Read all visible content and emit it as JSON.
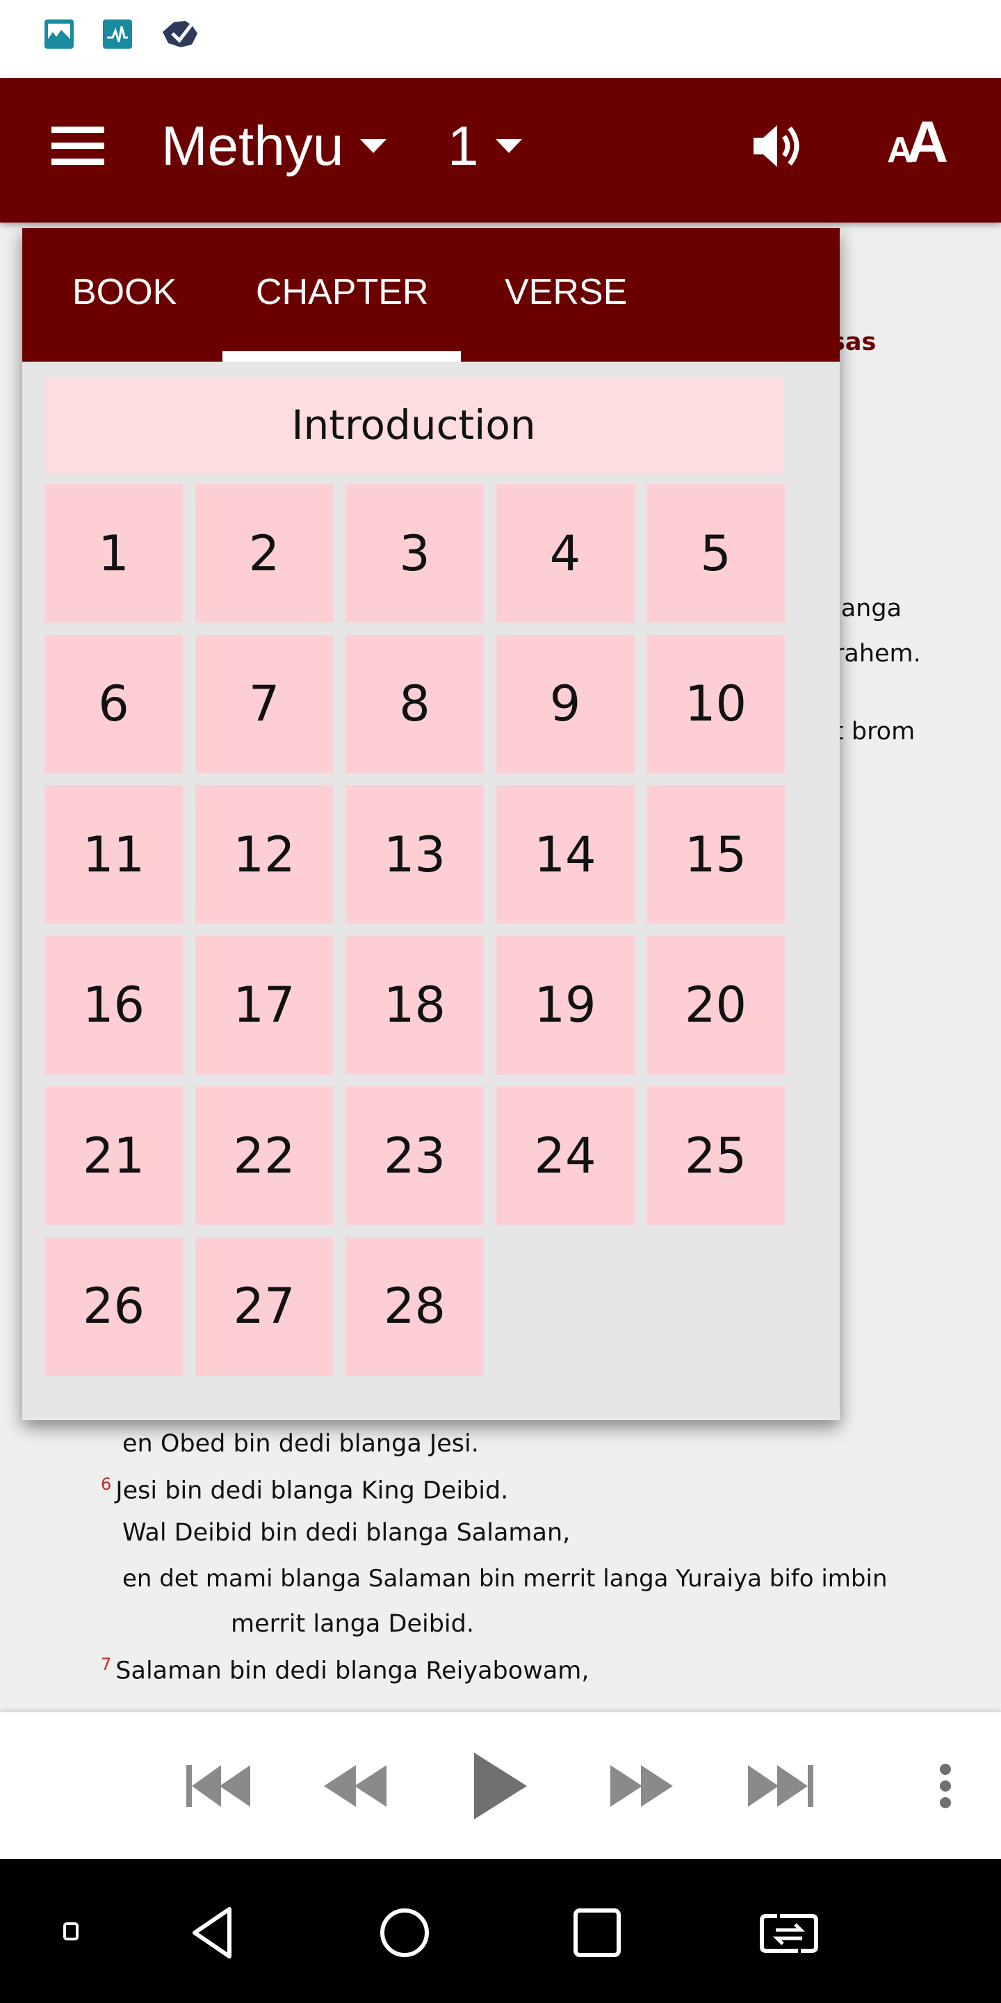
{
  "status_bar": {
    "icons": [
      "gallery-icon",
      "activity-icon",
      "australia-map-check-icon"
    ]
  },
  "app_bar": {
    "book": "Methyu",
    "chapter": "1",
    "icons": [
      "menu-icon",
      "speaker-icon",
      "text-size-icon"
    ],
    "text_size_label": "AA",
    "color": "#6b0000"
  },
  "background_text": {
    "heading_fragment": "sas",
    "fragments": [
      "langa",
      "rahem.",
      "t brom"
    ],
    "lines": [
      {
        "num": "",
        "text": "en Obed bin dedi blanga Jesi."
      },
      {
        "num": "6",
        "text": "Jesi bin dedi blanga King Deibid."
      },
      {
        "num": "",
        "text": "Wal Deibid bin dedi blanga Salaman,"
      },
      {
        "num": "",
        "text": "en det mami blanga Salaman bin merrit langa Yuraiya bifo imbin"
      },
      {
        "num": "",
        "text": "merrit langa Deibid."
      },
      {
        "num": "7",
        "text": "Salaman bin dedi blanga Reiyabowam,"
      }
    ]
  },
  "popup": {
    "tabs": [
      {
        "label": "BOOK"
      },
      {
        "label": "CHAPTER",
        "active": true
      },
      {
        "label": "VERSE"
      }
    ],
    "intro_label": "Introduction",
    "chapters": [
      "1",
      "2",
      "3",
      "4",
      "5",
      "6",
      "7",
      "8",
      "9",
      "10",
      "11",
      "12",
      "13",
      "14",
      "15",
      "16",
      "17",
      "18",
      "19",
      "20",
      "21",
      "22",
      "23",
      "24",
      "25",
      "26",
      "27",
      "28"
    ],
    "cell_color": "#fdcfd5"
  },
  "player": {
    "icons": [
      "skip-to-start-icon",
      "rewind-icon",
      "play-icon",
      "fast-forward-icon",
      "skip-to-end-icon",
      "more-vert-icon"
    ]
  },
  "nav_bar": {
    "icons": [
      "small-square-icon",
      "back-icon",
      "home-icon",
      "recents-icon",
      "rotate-icon"
    ]
  }
}
